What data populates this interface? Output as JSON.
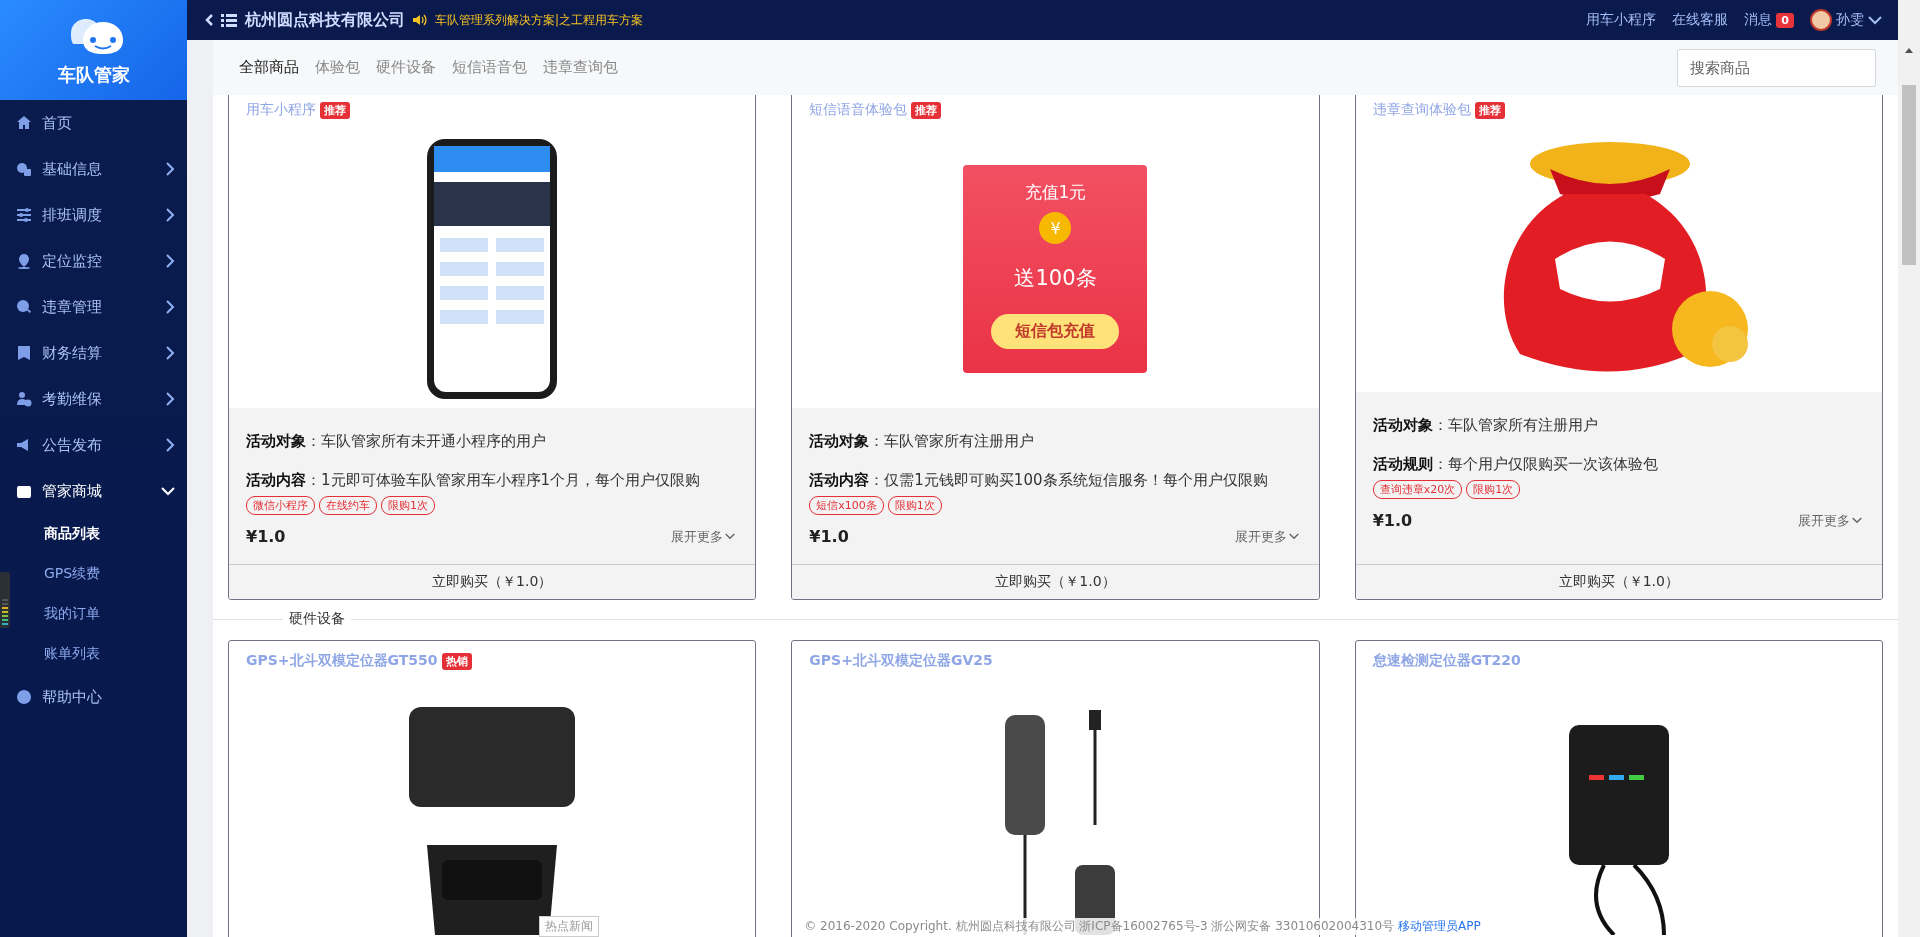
{
  "brand": {
    "name": "车队管家"
  },
  "sidebar": {
    "items": [
      {
        "label": "首页"
      },
      {
        "label": "基础信息",
        "expanded": false
      },
      {
        "label": "排班调度",
        "expanded": false
      },
      {
        "label": "定位监控",
        "expanded": false
      },
      {
        "label": "违章管理",
        "expanded": false
      },
      {
        "label": "财务结算",
        "expanded": false
      },
      {
        "label": "考勤维保",
        "expanded": false
      },
      {
        "label": "公告发布",
        "expanded": false
      },
      {
        "label": "管家商城",
        "expanded": true,
        "children": [
          {
            "label": "商品列表",
            "selected": true
          },
          {
            "label": "GPS续费",
            "selected": false
          },
          {
            "label": "我的订单",
            "selected": false
          },
          {
            "label": "账单列表",
            "selected": false
          }
        ]
      },
      {
        "label": "帮助中心"
      }
    ]
  },
  "header": {
    "company": "杭州圆点科技有限公司",
    "notice": "车队管理系列解决方案|之工程用车方案",
    "links": [
      "用车小程序",
      "在线客服"
    ],
    "messages": {
      "label": "消息",
      "count": "0"
    },
    "user": "孙雯"
  },
  "filter": {
    "tabs": [
      {
        "label": "全部商品",
        "selected": true
      },
      {
        "label": "体验包",
        "selected": false
      },
      {
        "label": "硬件设备",
        "selected": false
      },
      {
        "label": "短信语音包",
        "selected": false
      },
      {
        "label": "违章查询包",
        "selected": false
      }
    ],
    "search": {
      "placeholder": "搜索商品"
    }
  },
  "groups": [
    {
      "cards": [
        {
          "title": "用车小程序",
          "badge": "推荐",
          "details": [
            "**活动对象**：车队管家所有未开通小程序的用户",
            "**活动内容**：1元即可体验车队管家用车小程序1个月，每个用户仅限购"
          ],
          "tags": [
            "微信小程序",
            "在线约车",
            "限购1次"
          ],
          "price": "¥1.0",
          "more": "展开更多",
          "buy": "立即购买（￥1.0）"
        },
        {
          "title": "短信语音体验包",
          "badge": "推荐",
          "image_texts": [
            "充值1元",
            "¥",
            "送100条",
            "短信包充值"
          ],
          "details": [
            "**活动对象**：车队管家所有注册用户",
            "**活动内容**：仅需1元钱即可购买100条系统短信服务！每个用户仅限购"
          ],
          "tags": [
            "短信x100条",
            "限购1次"
          ],
          "price": "¥1.0",
          "more": "展开更多",
          "buy": "立即购买（￥1.0）"
        },
        {
          "title": "违章查询体验包",
          "badge": "推荐",
          "details": [
            "**活动对象**：车队管家所有注册用户",
            "**活动规则**：每个用户仅限购买一次该体验包"
          ],
          "tags": [
            "查询违章x20次",
            "限购1次"
          ],
          "price": "¥1.0",
          "more": "展开更多",
          "buy": "立即购买（￥1.0）"
        }
      ]
    },
    {
      "title": "硬件设备",
      "cards": [
        {
          "title": "GPS+北斗双模定位器GT550",
          "badge": "热销"
        },
        {
          "title": "GPS+北斗双模定位器GV25"
        },
        {
          "title": "怠速检测定位器GT220"
        }
      ]
    }
  ],
  "news_tab": "热点新闻",
  "footer": {
    "copyright": "© 2016-2020 Copyright. 杭州圆点科技有限公司 浙ICP备16002765号-3 浙公网安备 33010602004310号",
    "app_link": "移动管理员APP"
  }
}
